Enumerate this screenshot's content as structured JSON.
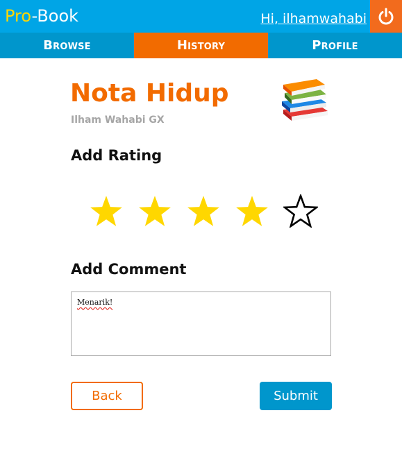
{
  "header": {
    "brand_pro": "Pro",
    "brand_dash": "-",
    "brand_book": "Book",
    "greeting": "Hi, ilhamwahabi",
    "logout_icon": "power-icon"
  },
  "nav": {
    "browse": "Browse",
    "history": "History",
    "profile": "Profile",
    "active": "history"
  },
  "book": {
    "title": "Nota Hidup",
    "author": "Ilham Wahabi GX",
    "icon": "books-stack-icon"
  },
  "rating": {
    "heading": "Add Rating",
    "value": 4,
    "max": 5
  },
  "comment": {
    "heading": "Add Comment",
    "value": "Menarik!"
  },
  "actions": {
    "back": "Back",
    "submit": "Submit"
  },
  "colors": {
    "header_bg": "#00a5e6",
    "nav_bg": "#0096cc",
    "accent_orange": "#f26b00",
    "brand_yellow": "#ffd700",
    "star_filled": "#ffd700"
  }
}
